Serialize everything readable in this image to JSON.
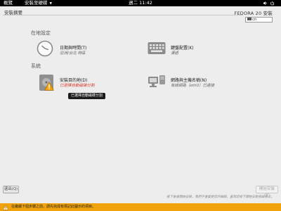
{
  "topbar": {
    "activities_label": "概覽",
    "app_menu_label": "安裝至硬碟",
    "clock": "週二 11:42",
    "icons": [
      "volume-icon",
      "power-icon"
    ]
  },
  "header": {
    "hub_title": "安裝摘要",
    "product": "FEDORA 20 安裝",
    "keyboard_layout": "cn"
  },
  "sections": {
    "localization": {
      "title": "在地設定",
      "datetime": {
        "title": "日期與時間(T)",
        "status": "亞洲/台北 時區",
        "icon": "clock-icon"
      },
      "keyboard": {
        "title": "鍵盤配置(K)",
        "status": "漢語",
        "icon": "keyboard-icon"
      }
    },
    "system": {
      "title": "系統",
      "destination": {
        "title": "安裝目的地(D)",
        "status": "已選擇自動磁碟分割",
        "icon": "disk-icon",
        "warning_icon": "warning-icon"
      },
      "network": {
        "title": "網路與主機名稱(N)",
        "status": "有線網路（eth0）已連接",
        "icon": "network-icon"
      }
    }
  },
  "tooltip": "已選擇自動磁碟分割",
  "footer": {
    "quit_label": "退出(Q)",
    "begin_label": "開始安裝(B)",
    "hint": "按下後會開始安裝，我們不會變更您的磁碟，直到您按下開始安裝按鈕為止。",
    "warning": "在繼續下個步驟之前，請先完成有標記此圖示的項目。"
  },
  "colors": {
    "topbar": "#000000",
    "background": "#ededed",
    "warning_bar": "#f0a30a",
    "error_text": "#d8352a"
  }
}
